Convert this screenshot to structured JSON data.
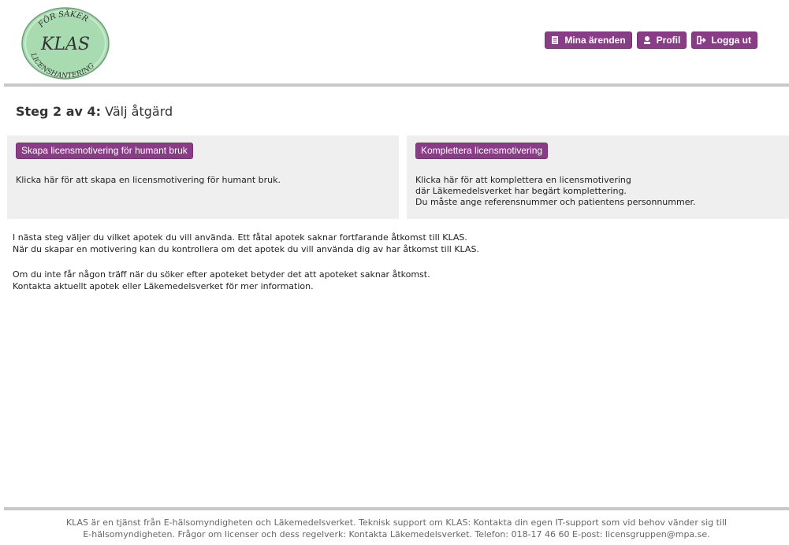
{
  "logo": {
    "top_text": "FÖR SÄKER",
    "main_text": "KLAS",
    "bottom_text": "LICENSHANTERING"
  },
  "nav": {
    "cases_label": "Mina ärenden",
    "profile_label": "Profil",
    "logout_label": "Logga ut"
  },
  "step": {
    "prefix": "Steg 2 av 4:",
    "title": "Välj åtgärd"
  },
  "cards": {
    "create": {
      "badge": "Skapa licensmotivering för humant bruk",
      "lines": [
        "Klicka här för att skapa en licensmotivering för humant bruk."
      ]
    },
    "complete": {
      "badge": "Komplettera licensmotivering",
      "lines": [
        "Klicka här för att komplettera en licensmotivering",
        "där Läkemedelsverket har begärt komplettering.",
        "Du måste ange referensnummer och patientens personnummer."
      ]
    }
  },
  "info": {
    "block1": [
      "I nästa steg väljer du vilket apotek du vill använda. Ett fåtal apotek saknar fortfarande åtkomst till KLAS.",
      "När du skapar en motivering kan du kontrollera om det apotek du vill använda dig av har åtkomst till KLAS."
    ],
    "block2": [
      "Om du inte får någon träff när du söker efter apoteket betyder det att apoteket saknar åtkomst.",
      "Kontakta aktuellt apotek eller Läkemedelsverket för mer information."
    ]
  },
  "footer": {
    "lines": [
      "KLAS är en tjänst från E-hälsomyndigheten och Läkemedelsverket. Teknisk support om KLAS: Kontakta din egen IT-support som vid behov vänder sig till",
      "E-hälsomyndigheten. Frågor om licenser och dess regelverk: Kontakta Läkemedelsverket. Telefon: 018-17 46 60 E-post: licensgruppen@mpa.se."
    ]
  },
  "colors": {
    "accent": "#8a3d87",
    "card_bg": "#efefef",
    "rule": "#c8c8c8",
    "logo_green": "#9fd4a6"
  }
}
